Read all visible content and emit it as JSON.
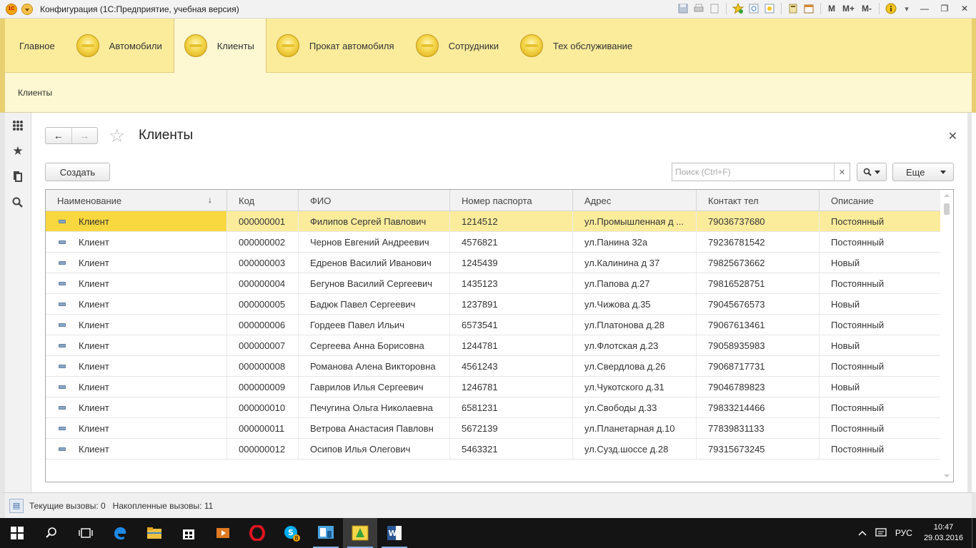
{
  "window": {
    "title": "Конфигурация  (1С:Предприятие, учебная версия)",
    "tools": [
      "M",
      "M+",
      "M-"
    ]
  },
  "sections": [
    {
      "label": "Главное",
      "icon": "desk-lamp-icon"
    },
    {
      "label": "Автомобили",
      "icon": "section-icon"
    },
    {
      "label": "Клиенты",
      "icon": "section-icon",
      "active": true
    },
    {
      "label": "Прокат автомобиля",
      "icon": "section-icon"
    },
    {
      "label": "Сотрудники",
      "icon": "section-icon"
    },
    {
      "label": "Тех обслуживание",
      "icon": "section-icon"
    }
  ],
  "breadcrumb": {
    "label": "Клиенты"
  },
  "form": {
    "title": "Клиенты",
    "create_label": "Создать",
    "search_placeholder": "Поиск (Ctrl+F)",
    "more_label": "Еще"
  },
  "table": {
    "columns": [
      "Наименование",
      "Код",
      "ФИО",
      "Номер паспорта",
      "Адрес",
      "Контакт тел",
      "Описание"
    ],
    "rows": [
      {
        "name": "Клиент",
        "code": "000000001",
        "fio": "Филипов Сергей Павлович",
        "passport": "1214512",
        "address": "ул.Промышленная д ...",
        "phone": "79036737680",
        "desc": "Постоянный"
      },
      {
        "name": "Клиент",
        "code": "000000002",
        "fio": "Чернов Евгений Андреевич",
        "passport": "4576821",
        "address": "ул.Панина 32а",
        "phone": "79236781542",
        "desc": "Постоянный"
      },
      {
        "name": "Клиент",
        "code": "000000003",
        "fio": "Едренов Василий Иванович",
        "passport": "1245439",
        "address": "ул.Калинина д 37",
        "phone": "79825673662",
        "desc": "Новый"
      },
      {
        "name": "Клиент",
        "code": "000000004",
        "fio": "Бегунов Василий Сергеевич",
        "passport": "1435123",
        "address": "ул.Папова д.27",
        "phone": "79816528751",
        "desc": "Постоянный"
      },
      {
        "name": "Клиент",
        "code": "000000005",
        "fio": "Бадюк Павел Сергеевич",
        "passport": "1237891",
        "address": "ул.Чижова д.35",
        "phone": "79045676573",
        "desc": "Новый"
      },
      {
        "name": "Клиент",
        "code": "000000006",
        "fio": "Гордеев Павел Ильич",
        "passport": "6573541",
        "address": "ул.Платонова д.28",
        "phone": "79067613461",
        "desc": "Постоянный"
      },
      {
        "name": "Клиент",
        "code": "000000007",
        "fio": "Сергеева Анна Борисовна",
        "passport": "1244781",
        "address": "ул.Флотская д.23",
        "phone": "79058935983",
        "desc": "Новый"
      },
      {
        "name": "Клиент",
        "code": "000000008",
        "fio": "Романова Алена Викторовна",
        "passport": "4561243",
        "address": "ул.Свердлова д.26",
        "phone": "79068717731",
        "desc": "Постоянный"
      },
      {
        "name": "Клиент",
        "code": "000000009",
        "fio": "Гаврилов Илья Сергеевич",
        "passport": "1246781",
        "address": "ул.Чукотского д.31",
        "phone": "79046789823",
        "desc": "Новый"
      },
      {
        "name": "Клиент",
        "code": "000000010",
        "fio": "Печугина Ольга Николаевна",
        "passport": "6581231",
        "address": "ул.Свободы д.33",
        "phone": "79833214466",
        "desc": "Постоянный"
      },
      {
        "name": "Клиент",
        "code": "000000011",
        "fio": "Ветрова Анастасия Павловн",
        "passport": "5672139",
        "address": "ул.Планетарная д.10",
        "phone": "77839831133",
        "desc": "Постоянный"
      },
      {
        "name": "Клиент",
        "code": "000000012",
        "fio": "Осипов Илья Олегович",
        "passport": "5463321",
        "address": "ул.Сузд.шоссе д.28",
        "phone": "79315673245",
        "desc": "Постоянный"
      }
    ]
  },
  "status": {
    "text": "Текущие вызовы: 0   Накопленные вызовы: 11"
  },
  "taskbar": {
    "language": "РУС",
    "time": "10:47",
    "date": "29.03.2016",
    "skype_badge": "8"
  },
  "colors": {
    "sections_bg": "#fbec9c",
    "selected_row": "#fbec9c",
    "selected_cell": "#f9d73f",
    "taskbar": "#141414"
  }
}
